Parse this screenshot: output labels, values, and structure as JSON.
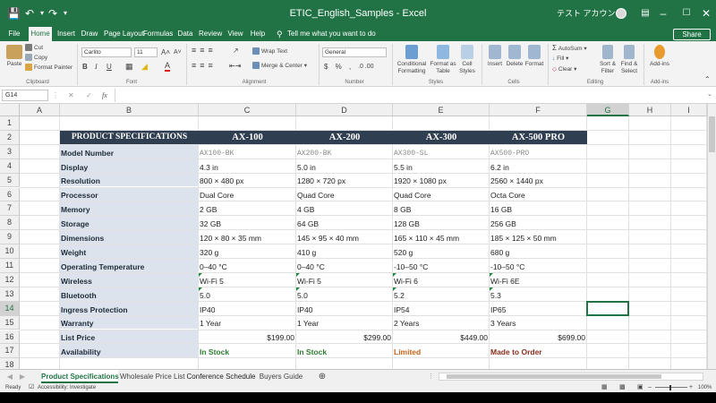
{
  "window": {
    "title": "ETIC_English_Samples  -  Excel",
    "user": "テスト アカウン",
    "share_label": "Share",
    "colors": {
      "brand": "#217346",
      "header_fill": "#2f3e50",
      "label_fill": "#dde3ec"
    }
  },
  "ribbon_tabs": [
    "File",
    "Home",
    "Insert",
    "Draw",
    "Page Layout",
    "Formulas",
    "Data",
    "Review",
    "View",
    "Help"
  ],
  "active_tab": "Home",
  "tell_me": "Tell me what you want to do",
  "ribbon": {
    "clipboard": {
      "paste": "Paste",
      "cut": "Cut",
      "copy": "Copy",
      "format_painter": "Format Painter",
      "group": "Clipboard"
    },
    "font": {
      "name": "Carlito",
      "size": "11",
      "group": "Font"
    },
    "alignment": {
      "wrap": "Wrap Text",
      "merge": "Merge & Center",
      "group": "Alignment"
    },
    "number": {
      "format": "General",
      "group": "Number"
    },
    "styles": {
      "conditional": "Conditional Formatting",
      "format_table": "Format as Table",
      "cell_styles": "Cell Styles",
      "group": "Styles"
    },
    "cells": {
      "insert": "Insert",
      "delete": "Delete",
      "format": "Format",
      "group": "Cells"
    },
    "editing": {
      "autosum": "AutoSum",
      "fill": "Fill",
      "clear": "Clear",
      "sort": "Sort & Filter",
      "find": "Find & Select",
      "group": "Editing"
    },
    "addins": {
      "label": "Add-ins",
      "group": "Add-ins"
    }
  },
  "formula_bar": {
    "name_box": "G14",
    "fx": "fx",
    "value": ""
  },
  "columns": [
    "A",
    "B",
    "C",
    "D",
    "E",
    "F",
    "G",
    "H",
    "I"
  ],
  "selected_column": "G",
  "rows": [
    "1",
    "2",
    "3",
    "4",
    "5",
    "6",
    "7",
    "8",
    "9",
    "10",
    "11",
    "12",
    "13",
    "14",
    "15",
    "16",
    "17",
    "18"
  ],
  "selected_row": "14",
  "header_row": [
    "PRODUCT SPECIFICATIONS",
    "AX-100",
    "AX-200",
    "AX-300",
    "AX-500 PRO"
  ],
  "spec_rows": [
    {
      "label": "Model Number",
      "values": [
        "AX100-BK",
        "AX200-BK",
        "AX300-SL",
        "AX500-PRO"
      ]
    },
    {
      "label": "Display",
      "values": [
        "4.3 in",
        "5.0 in",
        "5.5 in",
        "6.2 in"
      ]
    },
    {
      "label": "Resolution",
      "values": [
        "800 × 480 px",
        "1280 × 720 px",
        "1920 × 1080 px",
        "2560 × 1440 px"
      ]
    },
    {
      "label": "Processor",
      "values": [
        "Dual Core",
        "Quad Core",
        "Quad Core",
        "Octa Core"
      ]
    },
    {
      "label": "Memory",
      "values": [
        "2 GB",
        "4 GB",
        "8 GB",
        "16 GB"
      ]
    },
    {
      "label": "Storage",
      "values": [
        "32 GB",
        "64 GB",
        "128 GB",
        "256 GB"
      ]
    },
    {
      "label": "Dimensions",
      "values": [
        "120 × 80 × 35 mm",
        "145 × 95 × 40 mm",
        "165 × 110 × 45 mm",
        "185 × 125 × 50 mm"
      ]
    },
    {
      "label": "Weight",
      "values": [
        "320 g",
        "410 g",
        "520 g",
        "680 g"
      ]
    },
    {
      "label": "Operating Temperature",
      "values": [
        "0–40 °C",
        "0–40 °C",
        "-10–50 °C",
        "-10–50 °C"
      ]
    },
    {
      "label": "Wireless",
      "values": [
        "Wi-Fi 5",
        "Wi-Fi 5",
        "Wi-Fi 6",
        "Wi-Fi 6E"
      ]
    },
    {
      "label": "Bluetooth",
      "values": [
        "5.0",
        "5.0",
        "5.2",
        "5.3"
      ]
    },
    {
      "label": "Ingress Protection",
      "values": [
        "IP40",
        "IP40",
        "IP54",
        "IP65"
      ]
    },
    {
      "label": "Warranty",
      "values": [
        "1 Year",
        "1 Year",
        "2 Years",
        "3 Years"
      ]
    },
    {
      "label": "List Price",
      "values": [
        "$199.00",
        "$299.00",
        "$449.00",
        "$699.00"
      ]
    },
    {
      "label": "Availability",
      "values": [
        "In Stock",
        "In Stock",
        "Limited",
        "Made to Order"
      ]
    }
  ],
  "sheet_tabs": [
    "Product Specifications",
    "Wholesale Price List",
    "Conference Schedule",
    "Buyers Guide"
  ],
  "active_sheet": "Product Specifications",
  "status": {
    "ready": "Ready",
    "accessibility": "Accessibility: Investigate",
    "zoom": "100%"
  }
}
